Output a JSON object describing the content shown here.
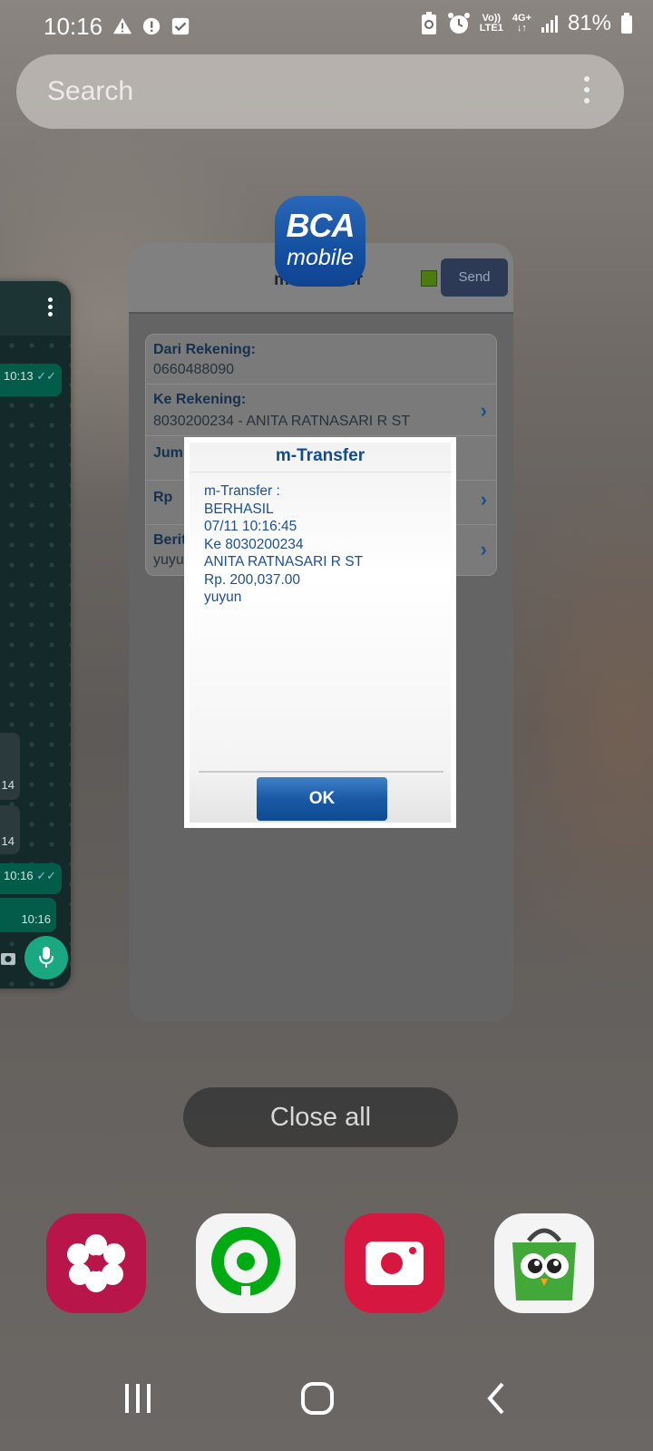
{
  "status_bar": {
    "time": "10:16",
    "network_top": "Vo))",
    "network_bottom": "LTE1",
    "network_type": "4G+",
    "battery": "81%",
    "icons": [
      "warning-icon",
      "alert-icon",
      "check-box-icon",
      "battery-saver-icon",
      "alarm-icon",
      "signal-icon",
      "battery-icon"
    ]
  },
  "search": {
    "placeholder": "Search",
    "menu_icon": "more-vert-icon"
  },
  "whatsapp_card": {
    "times": [
      "10:13",
      "14",
      "14",
      "10:16",
      "10:16"
    ],
    "icons": [
      "more-vert-icon",
      "camera-icon",
      "mic-icon"
    ]
  },
  "bca_card": {
    "app_badge_line1": "BCA",
    "app_badge_line2": "mobile",
    "title": "m-Transfer",
    "send_label": "Send",
    "form": {
      "from_label": "Dari Rekening:",
      "from_value": "0660488090",
      "to_label": "Ke Rekening:",
      "to_value": "8030200234 - ANITA RATNASARI R ST",
      "amount_partial_label": "Jum",
      "rp_label": "Rp",
      "news_label": "Berit",
      "news_value": "yuyun"
    }
  },
  "dialog": {
    "title": "m-Transfer",
    "lines": [
      "m-Transfer :",
      "BERHASIL",
      "07/11 10:16:45",
      "Ke 8030200234",
      "ANITA RATNASARI R ST",
      "Rp. 200,037.00",
      "yuyun"
    ],
    "ok_label": "OK"
  },
  "close_all_label": "Close all",
  "dock": [
    "blossom-app-icon",
    "gojek-app-icon",
    "screen-recorder-app-icon",
    "tokopedia-app-icon"
  ],
  "colors": {
    "accent_blue": "#0f4c8f",
    "whatsapp_green": "#1aa883"
  }
}
